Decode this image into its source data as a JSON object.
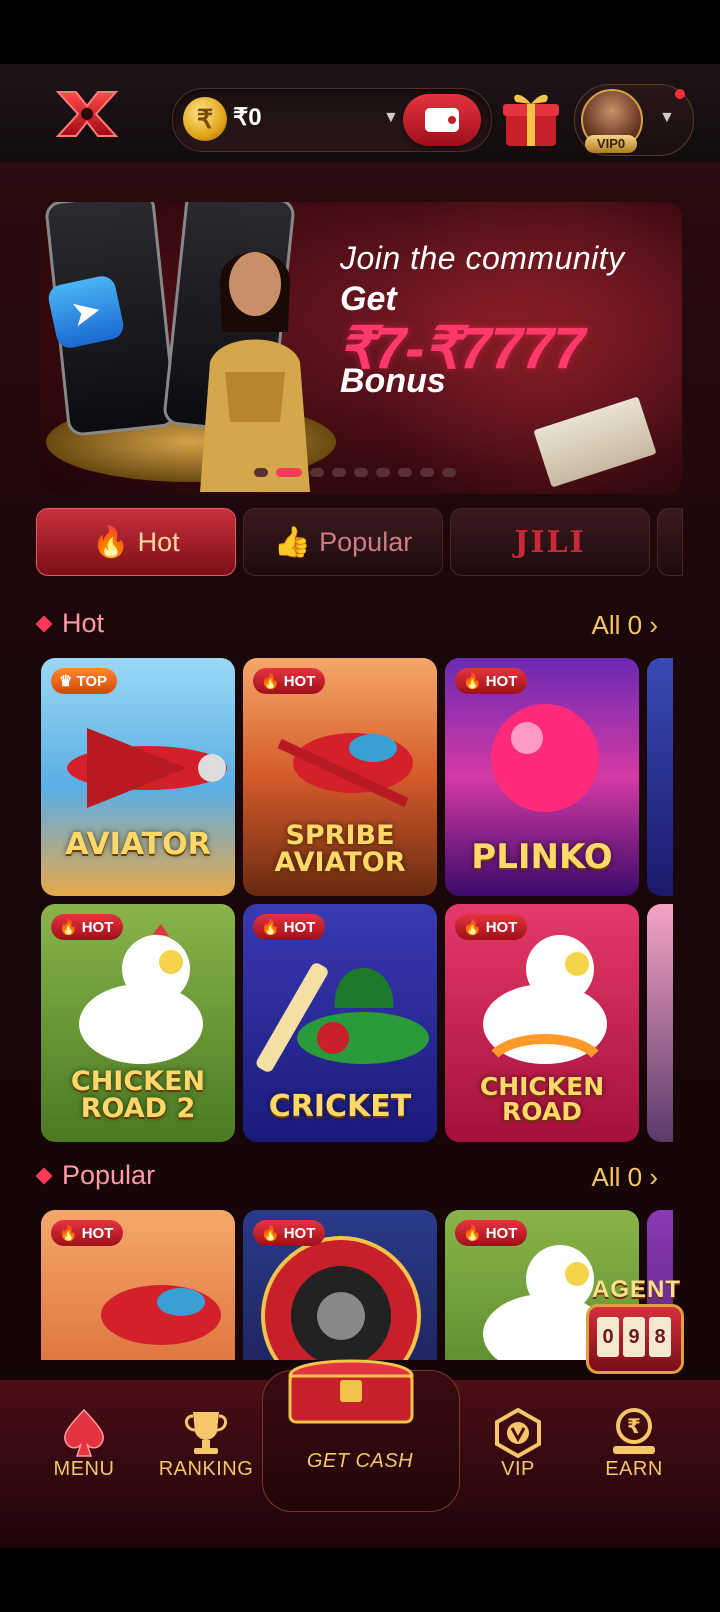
{
  "header": {
    "balance": "₹0",
    "vip_level": "VIP0"
  },
  "banner": {
    "line1": "Join the community",
    "line2": "Get",
    "line3": "₹7-₹7777",
    "line4": "Bonus",
    "dot_count": 9,
    "active_dot": 1
  },
  "category_tabs": [
    {
      "label": "Hot",
      "icon": "flame-icon",
      "active": true
    },
    {
      "label": "Popular",
      "icon": "thumbs-up-icon",
      "active": false
    },
    {
      "label": "JILI",
      "icon": "",
      "active": false
    }
  ],
  "sections": {
    "hot": {
      "title": "Hot",
      "see_all": "All 0",
      "games": [
        {
          "title": "AVIATOR",
          "badge": "TOP"
        },
        {
          "title": "SPRIBE\nAVIATOR",
          "badge": "HOT"
        },
        {
          "title": "PLINKO",
          "badge": "HOT"
        },
        {
          "title": "CHICKEN\nROAD 2",
          "badge": "HOT"
        },
        {
          "title": "CRICKET",
          "badge": "HOT"
        },
        {
          "title": "CHICKEN\nROAD",
          "badge": "HOT"
        }
      ]
    },
    "popular": {
      "title": "Popular",
      "see_all": "All 0",
      "games": [
        {
          "title": "",
          "badge": "HOT"
        },
        {
          "title": "",
          "badge": "HOT"
        },
        {
          "title": "",
          "badge": "HOT"
        }
      ]
    }
  },
  "agent": {
    "label": "AGENT",
    "reels": [
      "0",
      "9",
      "8"
    ]
  },
  "bottom_nav": {
    "menu": "MENU",
    "ranking": "RANKING",
    "get_cash": "GET CASH",
    "vip": "VIP",
    "earn": "EARN"
  },
  "colors": {
    "accent_red": "#e4343f",
    "gold_text": "#f5c66a",
    "section_title": "#ff9aa4",
    "background": "#1a0709"
  }
}
